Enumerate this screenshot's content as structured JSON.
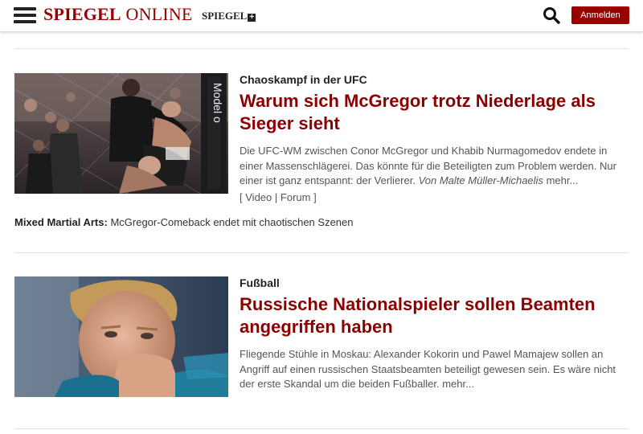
{
  "header": {
    "logo_bold": "SPIEGEL",
    "logo_light": " ONLINE",
    "sublogo": "SPIEGEL",
    "sublogo_plus": "+",
    "login_label": "Anmelden",
    "brand_color": "#990000"
  },
  "articles": [
    {
      "kicker": "Chaoskampf in der UFC",
      "headline": "Warum sich McGregor trotz Niederlage als Sieger sieht",
      "teaser": "Die UFC-WM zwischen Conor McGregor und Khabib Nurmagomedov endete in einer Massenschlägerei. Das könnte für die Beteiligten zum Problem werden. Nur einer ist ganz entspannt: der Verlierer.",
      "author": "Von Malte Müller-Michaelis",
      "more": "mehr...",
      "media_open": "[",
      "video": "Video",
      "sep": "|",
      "forum": "Forum",
      "media_close": "]",
      "image_desc": "ufc-fight-photo"
    },
    {
      "kicker": "Fußball",
      "headline": "Russische Nationalspieler sollen Beamten angegriffen haben",
      "teaser": "Fliegende Stühle in Moskau: Alexander Kokorin und Pawel Mamajew sollen an Angriff auf einen russischen Staatsbeamten beteiligt gewesen sein. Es wäre nicht der erste Skandal um die beiden Fußballer.",
      "more": "mehr...",
      "image_desc": "football-player-photo"
    }
  ],
  "related": {
    "label": "Mixed Martial Arts:",
    "text": "McGregor-Comeback endet mit chaotischen Szenen"
  }
}
